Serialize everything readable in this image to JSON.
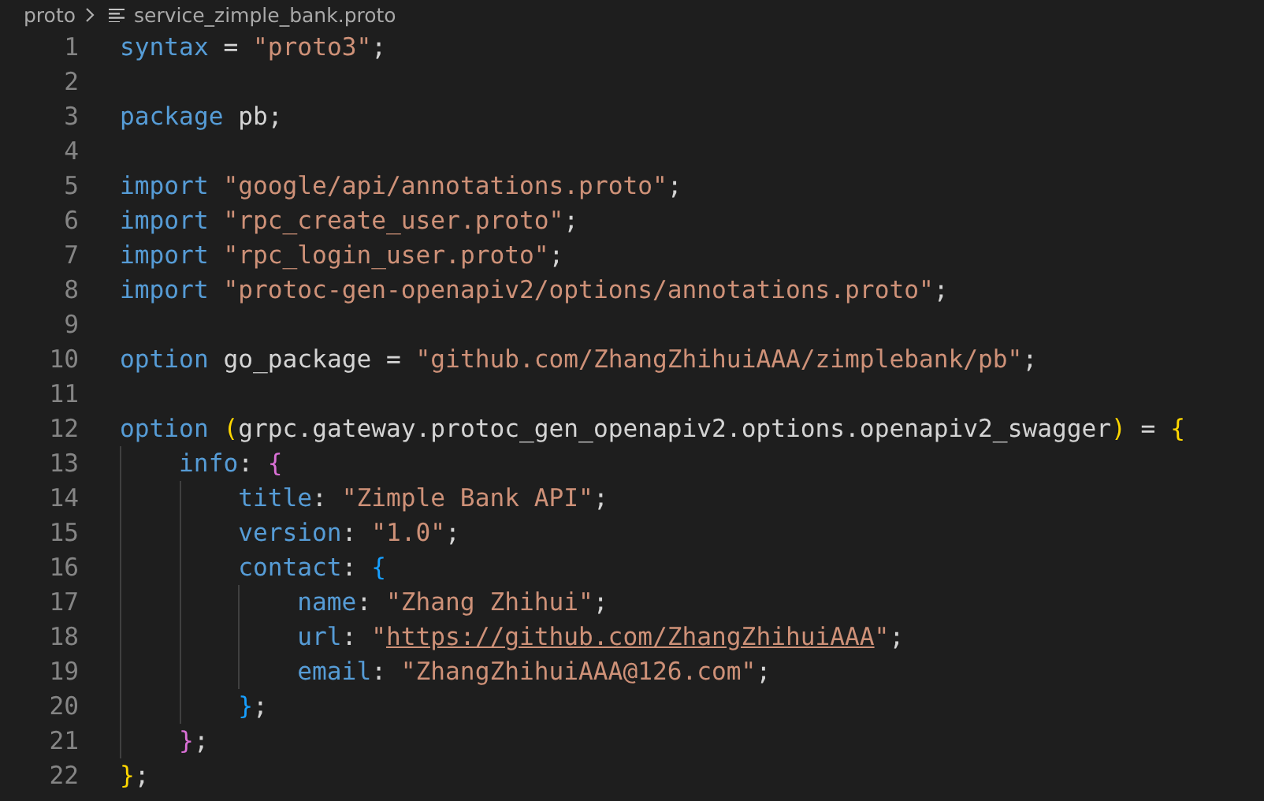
{
  "breadcrumb": [
    {
      "kind": "folder",
      "label": "proto"
    },
    {
      "kind": "file",
      "label": "service_zimple_bank.proto"
    }
  ],
  "lines": [
    {
      "number": "1",
      "tokens": [
        {
          "kind": "keyword",
          "text": "syntax"
        },
        {
          "kind": "plain",
          "text": " = "
        },
        {
          "kind": "string",
          "text": "\"proto3\""
        },
        {
          "kind": "plain",
          "text": ";"
        }
      ]
    },
    {
      "number": "2"
    },
    {
      "number": "3",
      "tokens": [
        {
          "kind": "keyword",
          "text": "package"
        },
        {
          "kind": "plain",
          "text": " pb;"
        }
      ]
    },
    {
      "number": "4"
    },
    {
      "number": "5",
      "tokens": [
        {
          "kind": "keyword",
          "text": "import"
        },
        {
          "kind": "string",
          "text": " \"google/api/annotations.proto\""
        },
        {
          "kind": "plain",
          "text": ";"
        }
      ]
    },
    {
      "number": "6",
      "tokens": [
        {
          "kind": "keyword",
          "text": "import"
        },
        {
          "kind": "string",
          "text": " \"rpc_create_user.proto\""
        },
        {
          "kind": "plain",
          "text": ";"
        }
      ]
    },
    {
      "number": "7",
      "tokens": [
        {
          "kind": "keyword",
          "text": "import"
        },
        {
          "kind": "string",
          "text": " \"rpc_login_user.proto\""
        },
        {
          "kind": "plain",
          "text": ";"
        }
      ]
    },
    {
      "number": "8",
      "tokens": [
        {
          "kind": "keyword",
          "text": "import"
        },
        {
          "kind": "string",
          "text": " \"protoc-gen-openapiv2/options/annotations.proto\""
        },
        {
          "kind": "plain",
          "text": ";"
        }
      ]
    },
    {
      "number": "9"
    },
    {
      "number": "10",
      "tokens": [
        {
          "kind": "keyword",
          "text": "option"
        },
        {
          "kind": "plain",
          "text": " go_package = "
        },
        {
          "kind": "string",
          "text": "\"github.com/ZhangZhihuiAAA/zimplebank/pb\""
        },
        {
          "kind": "plain",
          "text": ";"
        }
      ]
    },
    {
      "number": "11"
    },
    {
      "number": "12",
      "tokens": [
        {
          "kind": "keyword",
          "text": "option"
        },
        {
          "kind": "brace",
          "text": " (",
          "color": "#ffd700"
        },
        {
          "kind": "plain",
          "text": "grpc.gateway.protoc_gen_openapiv2.options.openapiv2_swagger"
        },
        {
          "kind": "brace",
          "text": ")",
          "color": "#ffd700"
        },
        {
          "kind": "plain",
          "text": " ="
        },
        {
          "kind": "brace",
          "text": " {",
          "color": "#ffd700"
        }
      ]
    },
    {
      "number": "13",
      "tokens": [
        {
          "kind": "keyword",
          "text": "    info"
        },
        {
          "kind": "plain",
          "text": ":"
        },
        {
          "kind": "brace",
          "text": " {",
          "color": "#da70d6"
        }
      ]
    },
    {
      "number": "14",
      "tokens": [
        {
          "kind": "keyword",
          "text": "        title"
        },
        {
          "kind": "plain",
          "text": ":"
        },
        {
          "kind": "string",
          "text": " \"Zimple Bank API\""
        },
        {
          "kind": "plain",
          "text": ";"
        }
      ]
    },
    {
      "number": "15",
      "tokens": [
        {
          "kind": "keyword",
          "text": "        version"
        },
        {
          "kind": "plain",
          "text": ":"
        },
        {
          "kind": "string",
          "text": " \"1.0\""
        },
        {
          "kind": "plain",
          "text": ";"
        }
      ]
    },
    {
      "number": "16",
      "tokens": [
        {
          "kind": "keyword",
          "text": "        contact"
        },
        {
          "kind": "plain",
          "text": ":"
        },
        {
          "kind": "brace",
          "text": " {",
          "color": "#179fff"
        }
      ]
    },
    {
      "number": "17",
      "tokens": [
        {
          "kind": "keyword",
          "text": "            name"
        },
        {
          "kind": "plain",
          "text": ":"
        },
        {
          "kind": "string",
          "text": " \"Zhang Zhihui\""
        },
        {
          "kind": "plain",
          "text": ";"
        }
      ]
    },
    {
      "number": "18",
      "tokens": [
        {
          "kind": "keyword",
          "text": "            url"
        },
        {
          "kind": "plain",
          "text": ":"
        },
        {
          "kind": "string",
          "text": " \""
        },
        {
          "kind": "link",
          "text": "https://github.com/ZhangZhihuiAAA"
        },
        {
          "kind": "string",
          "text": "\""
        },
        {
          "kind": "plain",
          "text": ";"
        }
      ]
    },
    {
      "number": "19",
      "tokens": [
        {
          "kind": "keyword",
          "text": "            email"
        },
        {
          "kind": "plain",
          "text": ":"
        },
        {
          "kind": "string",
          "text": " \"ZhangZhihuiAAA@126.com\""
        },
        {
          "kind": "plain",
          "text": ";"
        }
      ]
    },
    {
      "number": "20",
      "tokens": [
        {
          "kind": "brace",
          "text": "        }",
          "color": "#179fff"
        },
        {
          "kind": "plain",
          "text": ";"
        }
      ]
    },
    {
      "number": "21",
      "tokens": [
        {
          "kind": "brace",
          "text": "    }",
          "color": "#da70d6"
        },
        {
          "kind": "plain",
          "text": ";"
        }
      ]
    },
    {
      "number": "22",
      "tokens": [
        {
          "kind": "brace",
          "text": "}",
          "color": "#ffd700"
        },
        {
          "kind": "plain",
          "text": ";"
        }
      ]
    }
  ]
}
